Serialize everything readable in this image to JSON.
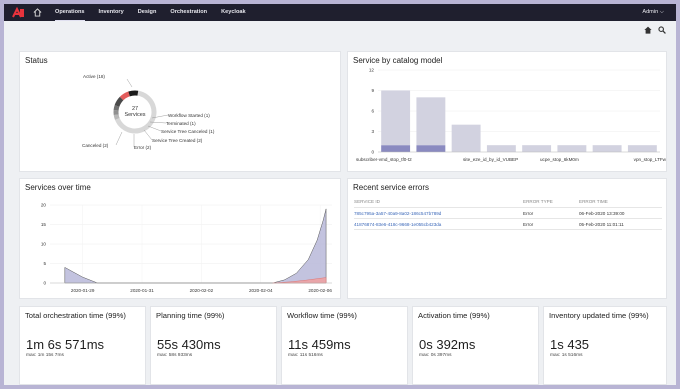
{
  "nav": {
    "items": [
      {
        "label": "Operations",
        "active": true
      },
      {
        "label": "Inventory",
        "active": false
      },
      {
        "label": "Design",
        "active": false
      },
      {
        "label": "Orchestration",
        "active": false
      },
      {
        "label": "Keycloak",
        "active": false
      }
    ],
    "user": "Admin ⌵"
  },
  "icons": {
    "home": "home-icon",
    "search": "search-icon",
    "logo": "logo-icon"
  },
  "status": {
    "title": "Status",
    "center_count": "27",
    "center_label": "Services",
    "labels": {
      "active": "Active (18)",
      "workflow_started": "Workflow Started (1)",
      "terminated": "Terminated (1)",
      "tree_canceled": "Service Tree Canceled (1)",
      "tree_created": "Service Tree Created (2)",
      "error": "Error (2)",
      "canceled": "Canceled (2)"
    },
    "chart_data": {
      "type": "pie",
      "slices": [
        {
          "label": "Active",
          "value": 18,
          "color": "#d8d8d8"
        },
        {
          "label": "Workflow Started",
          "value": 1,
          "color": "#b8b8b8"
        },
        {
          "label": "Terminated",
          "value": 1,
          "color": "#909090"
        },
        {
          "label": "Service Tree Canceled",
          "value": 1,
          "color": "#707070"
        },
        {
          "label": "Service Tree Created",
          "value": 2,
          "color": "#4a4a4a"
        },
        {
          "label": "Error",
          "value": 2,
          "color": "#e35d5d"
        },
        {
          "label": "Canceled",
          "value": 2,
          "color": "#1a1a1a"
        }
      ]
    }
  },
  "catalog": {
    "title": "Service by catalog model",
    "chart_data": {
      "type": "bar",
      "ylim": [
        0,
        12
      ],
      "yticks": [
        0,
        3,
        6,
        9,
        12
      ],
      "categories": [
        "subscriber-vmd_stop_tf0-t2",
        "",
        "site_e2e_id_by_id_VUBEP",
        "",
        "",
        "ucpe_stop_6kM0m",
        "",
        "vpn_stop_LTFw"
      ],
      "xlabels": [
        "subscriber-vmd_stop_tf0-t2",
        "site_e2e_id_by_id_VUBEP",
        "ucpe_stop_6kM0m",
        "vpn_stop_LTFw"
      ],
      "series": [
        {
          "values": [
            1,
            1,
            0,
            0,
            0,
            0,
            0,
            0
          ],
          "color": "#8a8ac0"
        },
        {
          "values": [
            8,
            7,
            4,
            1,
            1,
            1,
            1,
            1
          ],
          "color": "#d2d2e0"
        }
      ]
    }
  },
  "sot": {
    "title": "Services over time",
    "chart_data": {
      "type": "area",
      "ylim": [
        0,
        20
      ],
      "yticks": [
        0,
        5,
        10,
        15,
        20
      ],
      "xticks": [
        "2020-01-29",
        "2020-01-31",
        "2020-02-02",
        "2020-02-04",
        "2020-02-06"
      ],
      "x_days": [
        0,
        2,
        4,
        6,
        8
      ],
      "series": [
        {
          "name": "",
          "color": "#b9b9d9",
          "points": [
            [
              -0.6,
              4
            ],
            [
              0,
              1.5
            ],
            [
              0.5,
              0
            ],
            [
              6.4,
              0
            ],
            [
              6.8,
              0.8
            ],
            [
              7.2,
              2.5
            ],
            [
              7.6,
              6
            ],
            [
              7.9,
              11
            ],
            [
              8.1,
              16
            ],
            [
              8.2,
              19
            ]
          ]
        },
        {
          "name": "",
          "color": "#f0a0a0",
          "points": [
            [
              6.4,
              0
            ],
            [
              7,
              0.3
            ],
            [
              7.5,
              0.7
            ],
            [
              8.2,
              1.4
            ]
          ]
        }
      ]
    }
  },
  "errors": {
    "title": "Recent service errors",
    "headers": [
      "SERVICE ID",
      "ERROR TYPE",
      "ERROR TIME"
    ],
    "rows": [
      [
        "785c795a-3a57-40a9-8a02-186c547b789d",
        "Error",
        "06-Feb-2020 13:39:00"
      ],
      [
        "41876874-83e6-418c-9668-1e055cb423da",
        "Error",
        "05-Feb-2020 11:01:11"
      ]
    ]
  },
  "metrics": [
    {
      "title": "Total orchestration time (99%)",
      "value": "1m 6s 571ms",
      "sub": "max: 1m 15s 7ms"
    },
    {
      "title": "Planning time (99%)",
      "value": "55s 430ms",
      "sub": "max: 58s 933ms"
    },
    {
      "title": "Workflow time (99%)",
      "value": "11s 459ms",
      "sub": "max: 11s 516ms"
    },
    {
      "title": "Activation time (99%)",
      "value": "0s 392ms",
      "sub": "max: 0s 397ms"
    },
    {
      "title": "Inventory updated time (99%)",
      "value": "1s 435",
      "sub": "max: 1s 516ms"
    }
  ]
}
